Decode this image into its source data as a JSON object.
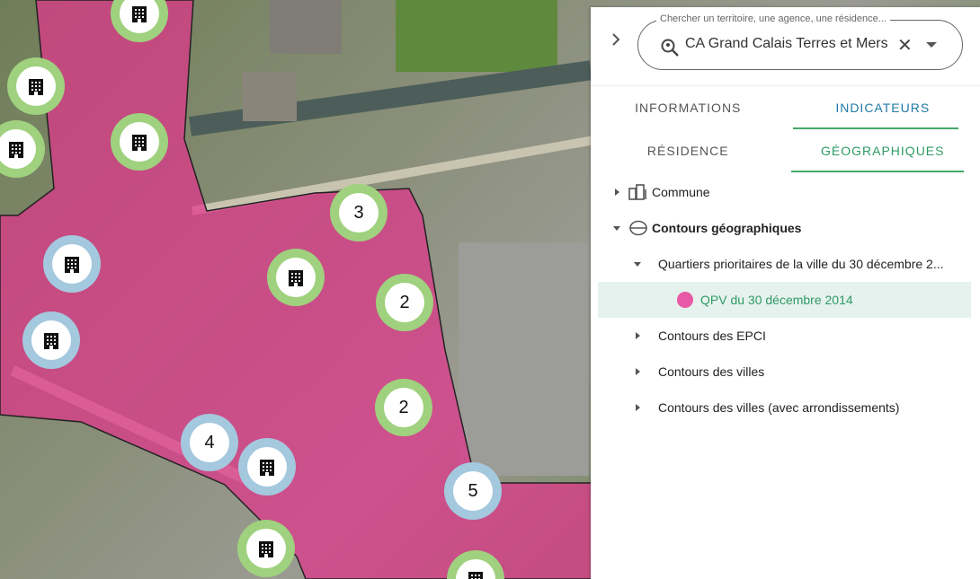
{
  "map": {
    "markers": [
      {
        "kind": "building",
        "color": "green"
      },
      {
        "kind": "building",
        "color": "green"
      },
      {
        "kind": "building",
        "color": "green"
      },
      {
        "kind": "building",
        "color": "green"
      },
      {
        "kind": "count",
        "color": "green",
        "value": "3"
      },
      {
        "kind": "building",
        "color": "blue"
      },
      {
        "kind": "building",
        "color": "green"
      },
      {
        "kind": "count",
        "color": "green",
        "value": "2"
      },
      {
        "kind": "building",
        "color": "blue"
      },
      {
        "kind": "count",
        "color": "green",
        "value": "2"
      },
      {
        "kind": "count",
        "color": "blue",
        "value": "4"
      },
      {
        "kind": "building",
        "color": "blue"
      },
      {
        "kind": "count",
        "color": "blue",
        "value": "5"
      },
      {
        "kind": "building",
        "color": "green"
      },
      {
        "kind": "building",
        "color": "green"
      }
    ],
    "qpv_color": "#e0358a"
  },
  "panel": {
    "search": {
      "legend": "Chercher un territoire, une agence, une résidence...",
      "value": "CA Grand Calais Terres et Mers"
    },
    "tabs": [
      {
        "label": "INFORMATIONS",
        "active": false
      },
      {
        "label": "INDICATEURS",
        "active": true
      }
    ],
    "subtabs": [
      {
        "label": "RÉSIDENCE",
        "active": false
      },
      {
        "label": "GÉOGRAPHIQUES",
        "active": true
      }
    ],
    "tree": [
      {
        "label": "Commune",
        "icon": "buildings-icon",
        "expanded": false
      },
      {
        "label": "Contours géographiques",
        "icon": "globe-icon",
        "expanded": true
      },
      {
        "label": "Quartiers prioritaires de la ville du 30 décembre 2...",
        "expanded": true
      },
      {
        "label": "QPV du 30 décembre 2014",
        "icon": "pink-dot-icon",
        "selected": true
      },
      {
        "label": "Contours des EPCI",
        "expanded": false
      },
      {
        "label": "Contours des villes",
        "expanded": false
      },
      {
        "label": "Contours des villes (avec arrondissements)",
        "expanded": false
      }
    ],
    "accent": "#2e9a64",
    "tab_accent": "#1f7aa8"
  }
}
